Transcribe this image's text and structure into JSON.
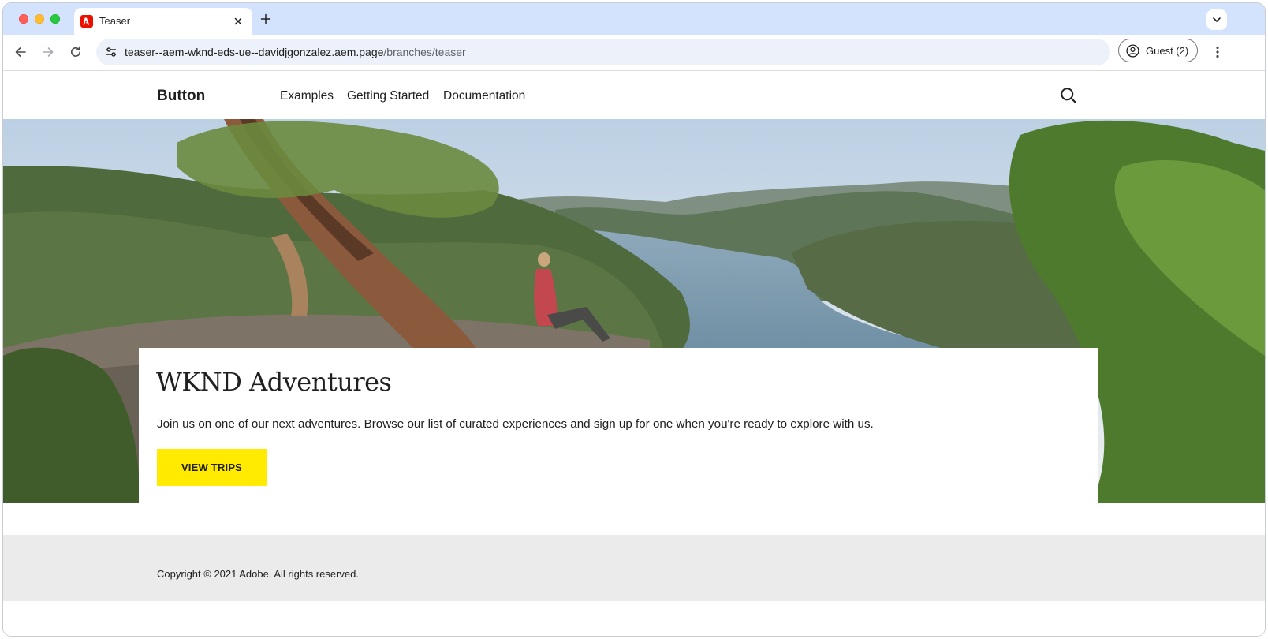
{
  "browser": {
    "tab": {
      "title": "Teaser",
      "favicon": "adobe-icon"
    },
    "url": {
      "host": "teaser--aem-wknd-eds-ue--davidjgonzalez.aem.page",
      "path": "/branches/teaser"
    },
    "profile": {
      "label": "Guest (2)"
    },
    "colors": {
      "tabstrip": "#d3e3fd",
      "omnibox": "#edf2fa"
    }
  },
  "site": {
    "brand": "Button",
    "nav": [
      "Examples",
      "Getting Started",
      "Documentation"
    ],
    "search_icon": "search-icon"
  },
  "teaser": {
    "title": "WKND Adventures",
    "description": "Join us on one of our next adventures. Browse our list of curated experiences and sign up for one when you're ready to explore with us.",
    "cta_label": "VIEW TRIPS",
    "cta_color": "#ffea00"
  },
  "footer": {
    "copyright": "Copyright © 2021 Adobe. All rights reserved."
  }
}
